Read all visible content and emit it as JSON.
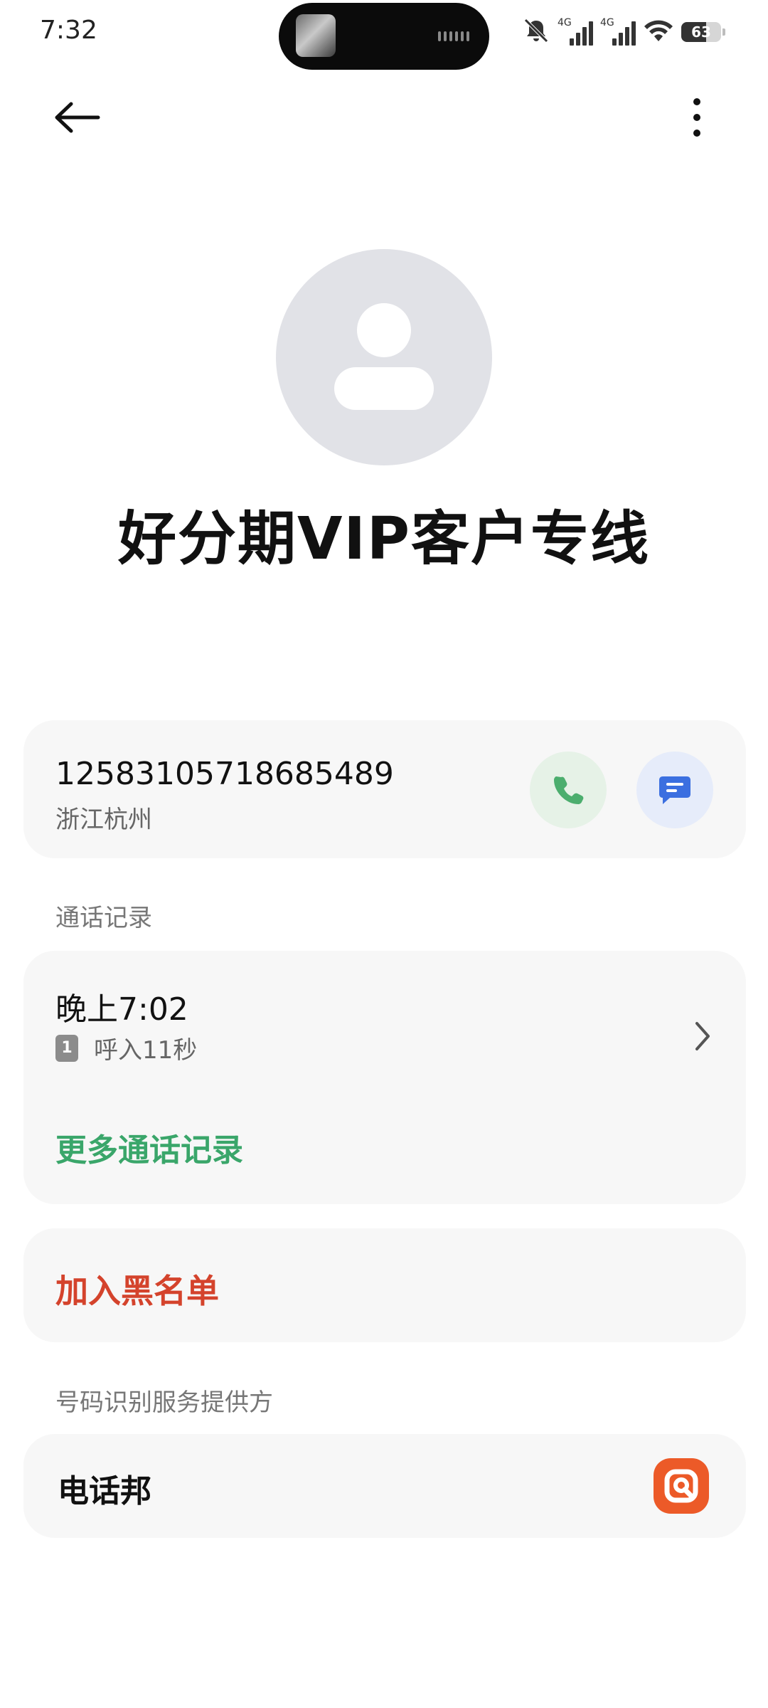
{
  "status_bar": {
    "time": "7:32",
    "sim1_label": "4G",
    "sim2_label": "4G",
    "battery_level": "63",
    "battery_fraction": 0.63,
    "icons": [
      "bell-muted-icon",
      "signal-4g-icon",
      "signal-4g-icon",
      "wifi-icon",
      "battery-icon"
    ]
  },
  "toolbar": {
    "back_icon": "arrow-left-icon",
    "more_icon": "more-vertical-icon"
  },
  "contact": {
    "name": "好分期VIP客户专线",
    "avatar_icon": "person-placeholder-icon"
  },
  "number_card": {
    "number": "12583105718685489",
    "location": "浙江杭州",
    "call_icon": "phone-icon",
    "message_icon": "message-icon"
  },
  "call_log": {
    "section_label": "通话记录",
    "entries": [
      {
        "time": "晚上7:02",
        "sim": "1",
        "detail": "呼入11秒"
      }
    ],
    "more_label": "更多通话记录"
  },
  "block": {
    "label": "加入黑名单"
  },
  "provider": {
    "section_label": "号码识别服务提供方",
    "name": "电话邦",
    "logo_icon": "dianhuabang-logo-icon"
  },
  "colors": {
    "card_bg": "#f7f7f7",
    "accent_green": "#3aa66a",
    "danger_red": "#d4432c",
    "call_btn_bg": "#e6f2e7",
    "msg_btn_bg": "#e6ecfa",
    "msg_icon": "#3b6fe0",
    "provider_orange": "#ec5a28",
    "avatar_bg": "#e1e2e7"
  }
}
